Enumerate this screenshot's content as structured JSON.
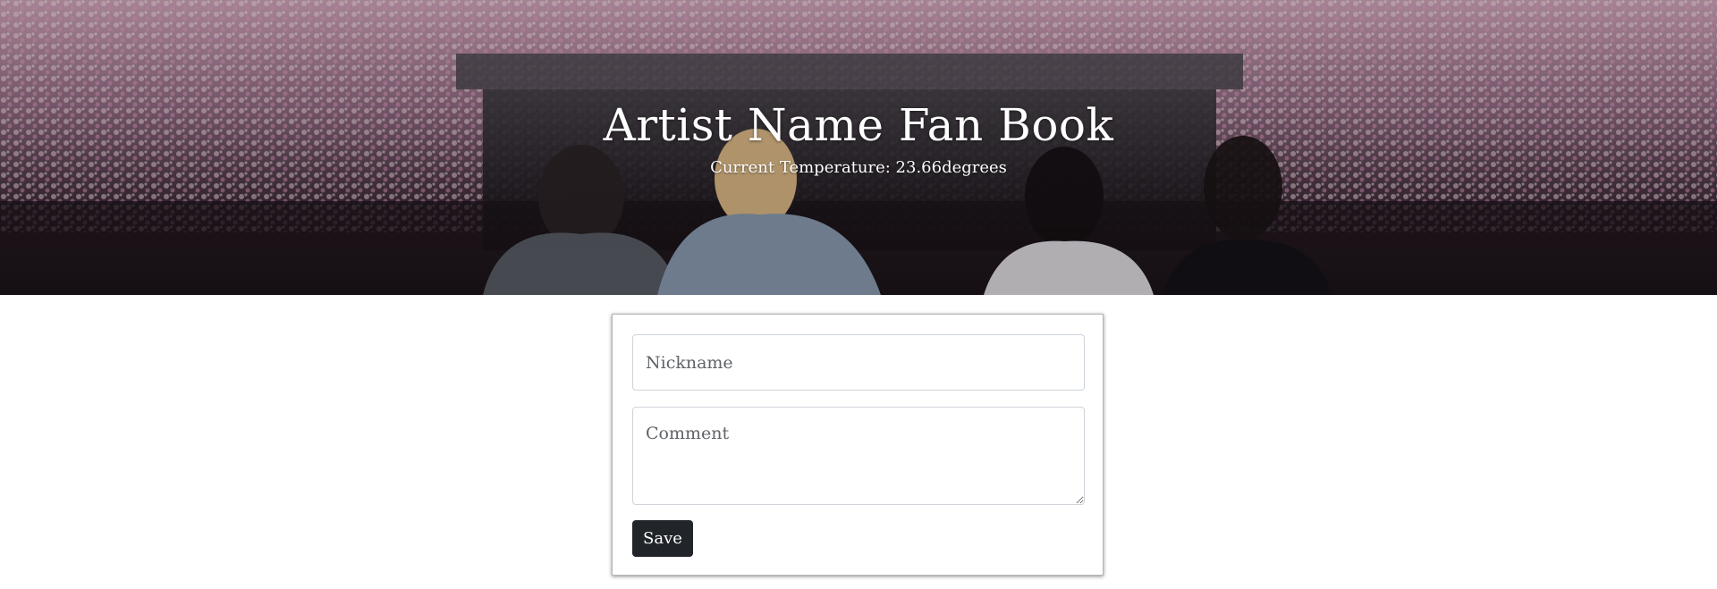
{
  "hero": {
    "title": "Artist Name Fan Book",
    "temperature_text": "Current Temperature: 23.66degrees"
  },
  "form": {
    "nickname_placeholder": "Nickname",
    "comment_placeholder": "Comment",
    "save_label": "Save"
  },
  "colors": {
    "button_bg": "#212529",
    "hero_text": "#ffffff"
  }
}
